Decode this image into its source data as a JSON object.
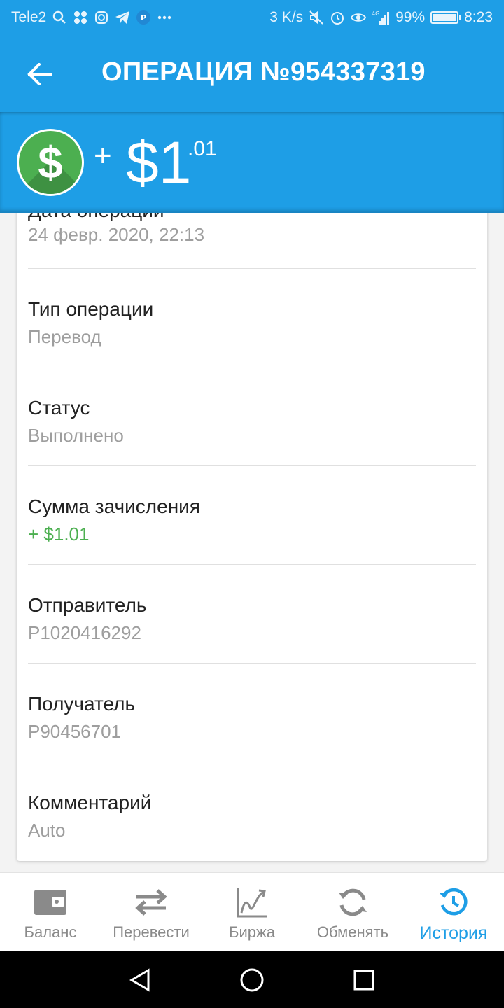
{
  "status_bar": {
    "carrier": "Tele2",
    "speed": "3 K/s",
    "network": "4G",
    "battery": "99%",
    "time": "8:23"
  },
  "header": {
    "title": "ОПЕРАЦИЯ №954337319",
    "back_icon": "arrow-back-icon"
  },
  "amount": {
    "currency_icon": "dollar-icon",
    "sign": "+",
    "main": "$1",
    "cents": ".01",
    "badge_color": "#4caf50"
  },
  "details": [
    {
      "label": "Дата операции",
      "value": "24 февр. 2020, 22:13"
    },
    {
      "label": "Тип операции",
      "value": "Перевод"
    },
    {
      "label": "Статус",
      "value": "Выполнено"
    },
    {
      "label": "Сумма зачисления",
      "value": "+ $1.01"
    },
    {
      "label": "Отправитель",
      "value": "P1020416292"
    },
    {
      "label": "Получатель",
      "value": "P90456701"
    },
    {
      "label": "Комментарий",
      "value": "Auto"
    }
  ],
  "bottom_nav": [
    {
      "label": "Баланс",
      "icon": "wallet-icon"
    },
    {
      "label": "Перевести",
      "icon": "transfer-icon"
    },
    {
      "label": "Биржа",
      "icon": "chart-icon"
    },
    {
      "label": "Обменять",
      "icon": "exchange-icon"
    },
    {
      "label": "История",
      "icon": "history-icon",
      "active": true
    }
  ],
  "colors": {
    "primary": "#1e9ee6",
    "positive": "#4caf50",
    "muted": "#9e9e9e"
  }
}
